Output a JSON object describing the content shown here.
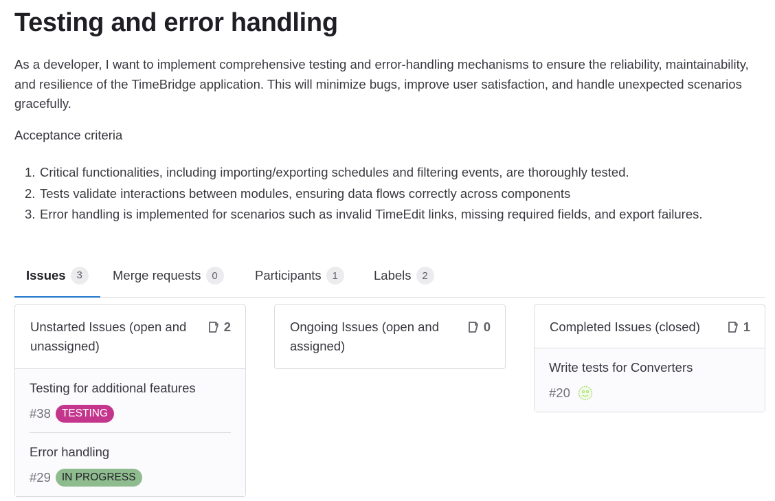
{
  "page": {
    "title": "Testing and error handling",
    "description": "As a developer, I want to implement comprehensive testing and error-handling mechanisms to ensure the reliability, maintainability, and resilience of the TimeBridge application. This will minimize bugs, improve user satisfaction, and handle unexpected scenarios gracefully.",
    "acceptance_title": "Acceptance criteria",
    "criteria": [
      {
        "num": "1.",
        "text": "Critical functionalities, including importing/exporting schedules and filtering events, are thoroughly tested."
      },
      {
        "num": "2.",
        "text": "Tests validate interactions between modules, ensuring data flows correctly across components"
      },
      {
        "num": "3.",
        "text": "Error handling is implemented for scenarios such as invalid TimeEdit links, missing required fields, and export failures."
      }
    ]
  },
  "tabs": [
    {
      "label": "Issues",
      "count": "3",
      "active": true
    },
    {
      "label": "Merge requests",
      "count": "0",
      "active": false
    },
    {
      "label": "Participants",
      "count": "1",
      "active": false
    },
    {
      "label": "Labels",
      "count": "2",
      "active": false
    }
  ],
  "columns": [
    {
      "title": "Unstarted Issues (open and unassigned)",
      "count": "2",
      "issues": [
        {
          "title": "Testing for additional features",
          "ref": "#38",
          "label": "TESTING",
          "label_color": "#c4368c"
        },
        {
          "title": "Error handling",
          "ref": "#29",
          "label": "IN PROGRESS",
          "label_color": "#8fbc8f"
        }
      ]
    },
    {
      "title": "Ongoing Issues (open and assigned)",
      "count": "0",
      "issues": []
    },
    {
      "title": "Completed Issues (closed)",
      "count": "1",
      "issues": [
        {
          "title": "Write tests for Converters",
          "ref": "#20",
          "avatar": "avatar-icon"
        }
      ]
    }
  ],
  "colors": {
    "accent": "#1f75cb",
    "testing": "#c4368c",
    "in_progress": "#8fbc8f",
    "avatar": "#a4e06a"
  }
}
